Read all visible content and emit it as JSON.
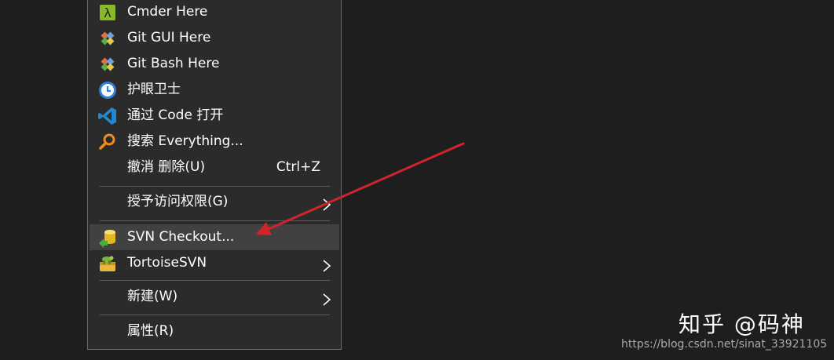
{
  "menu": {
    "items": [
      {
        "label": "Cmder Here",
        "icon": "cmder-icon"
      },
      {
        "label": "Git GUI Here",
        "icon": "git-gui-icon"
      },
      {
        "label": "Git Bash Here",
        "icon": "git-bash-icon"
      },
      {
        "label": "护眼卫士",
        "icon": "eye-care-icon"
      },
      {
        "label": "通过 Code 打开",
        "icon": "vscode-icon"
      },
      {
        "label": "搜索 Everything...",
        "icon": "everything-search-icon"
      },
      {
        "label": "撤消 删除(U)",
        "shortcut": "Ctrl+Z"
      },
      {
        "label": "授予访问权限(G)",
        "submenu": true
      },
      {
        "label": "SVN Checkout...",
        "icon": "svn-checkout-icon",
        "highlighted": true
      },
      {
        "label": "TortoiseSVN",
        "icon": "tortoisesvn-icon",
        "submenu": true
      },
      {
        "label": "新建(W)",
        "submenu": true
      },
      {
        "label": "属性(R)"
      }
    ]
  },
  "watermark": {
    "brand": "知乎 @码神",
    "url": "https://blog.csdn.net/sinat_33921105"
  },
  "colors": {
    "background": "#1e1e1e",
    "menu_background": "#2b2b2b",
    "highlight": "#414141",
    "annotation_arrow": "#d0242b"
  }
}
